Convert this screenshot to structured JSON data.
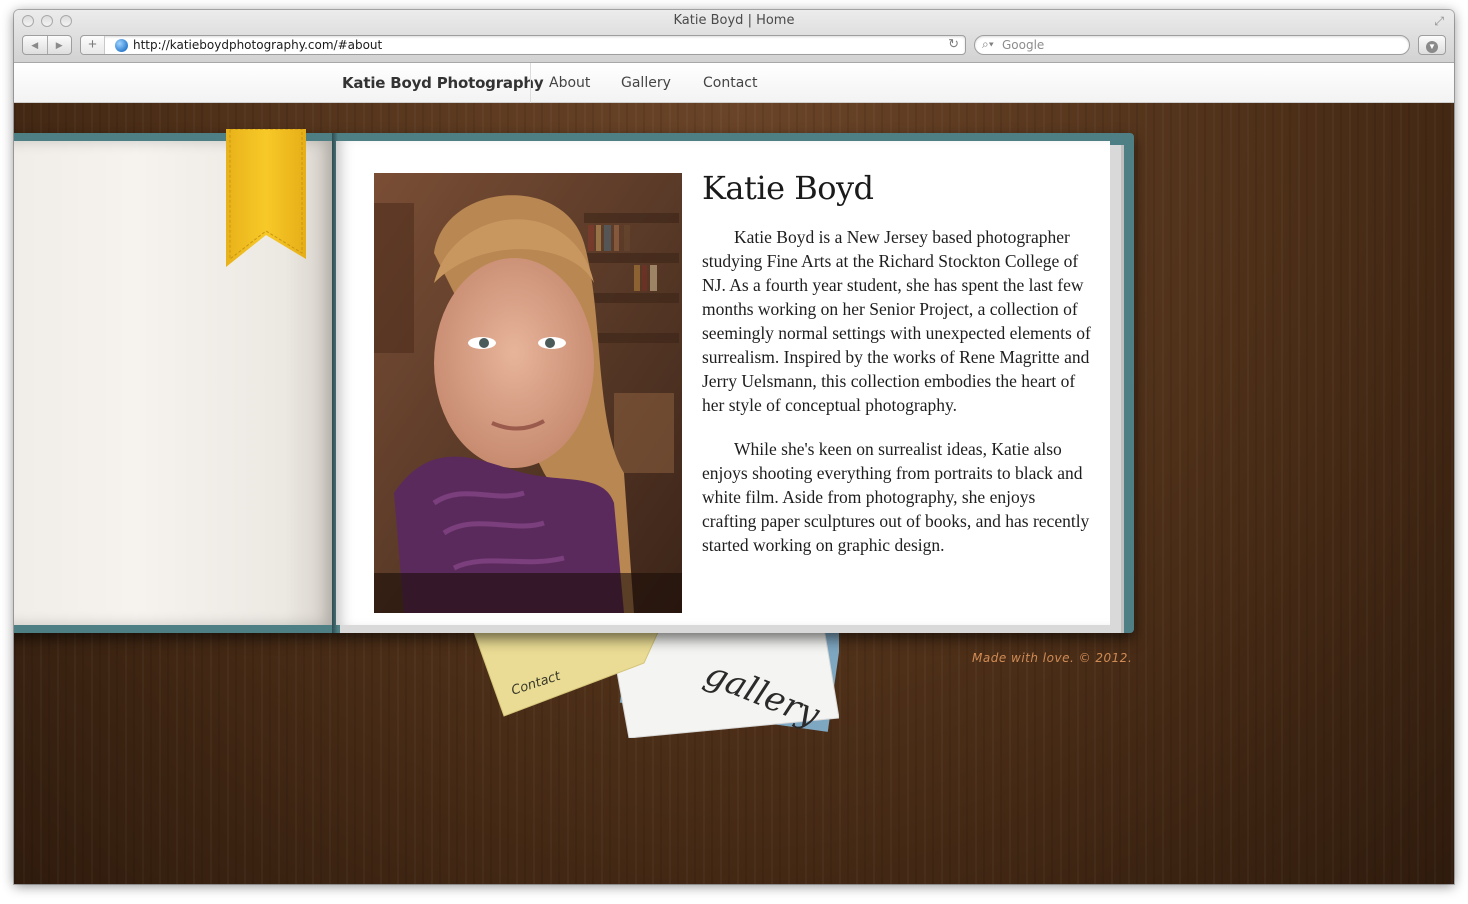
{
  "browser": {
    "window_title": "Katie Boyd | Home",
    "url": "http://katieboydphotography.com/#about",
    "search_placeholder": "Google"
  },
  "site": {
    "brand": "Katie Boyd Photography",
    "nav": [
      "About",
      "Gallery",
      "Contact"
    ]
  },
  "about": {
    "name": "Katie Boyd",
    "paragraphs": [
      "Katie Boyd is a New Jersey based photographer studying Fine Arts at the Richard Stockton College of NJ.  As a fourth year student, she has spent the last few months working on her Senior Project, a collection of seemingly normal settings with unexpected elements of surrealism.  Inspired by the works of Rene Magritte and Jerry Uelsmann, this collection embodies the heart of her style of conceptual photography.",
      "While she's keen on surrealist ideas, Katie also enjoys shooting everything from portraits to black and white film.  Aside from photography, she enjoys crafting paper sculptures out of books, and has recently started working on graphic design."
    ]
  },
  "cards": {
    "contact": "Contact",
    "gallery": "gallery"
  },
  "footer": {
    "note": "Made with love. © 2012."
  },
  "colors": {
    "book_cover": "#4e7f85",
    "bookmark": "#f5c224",
    "footer_text": "#d08b55"
  }
}
